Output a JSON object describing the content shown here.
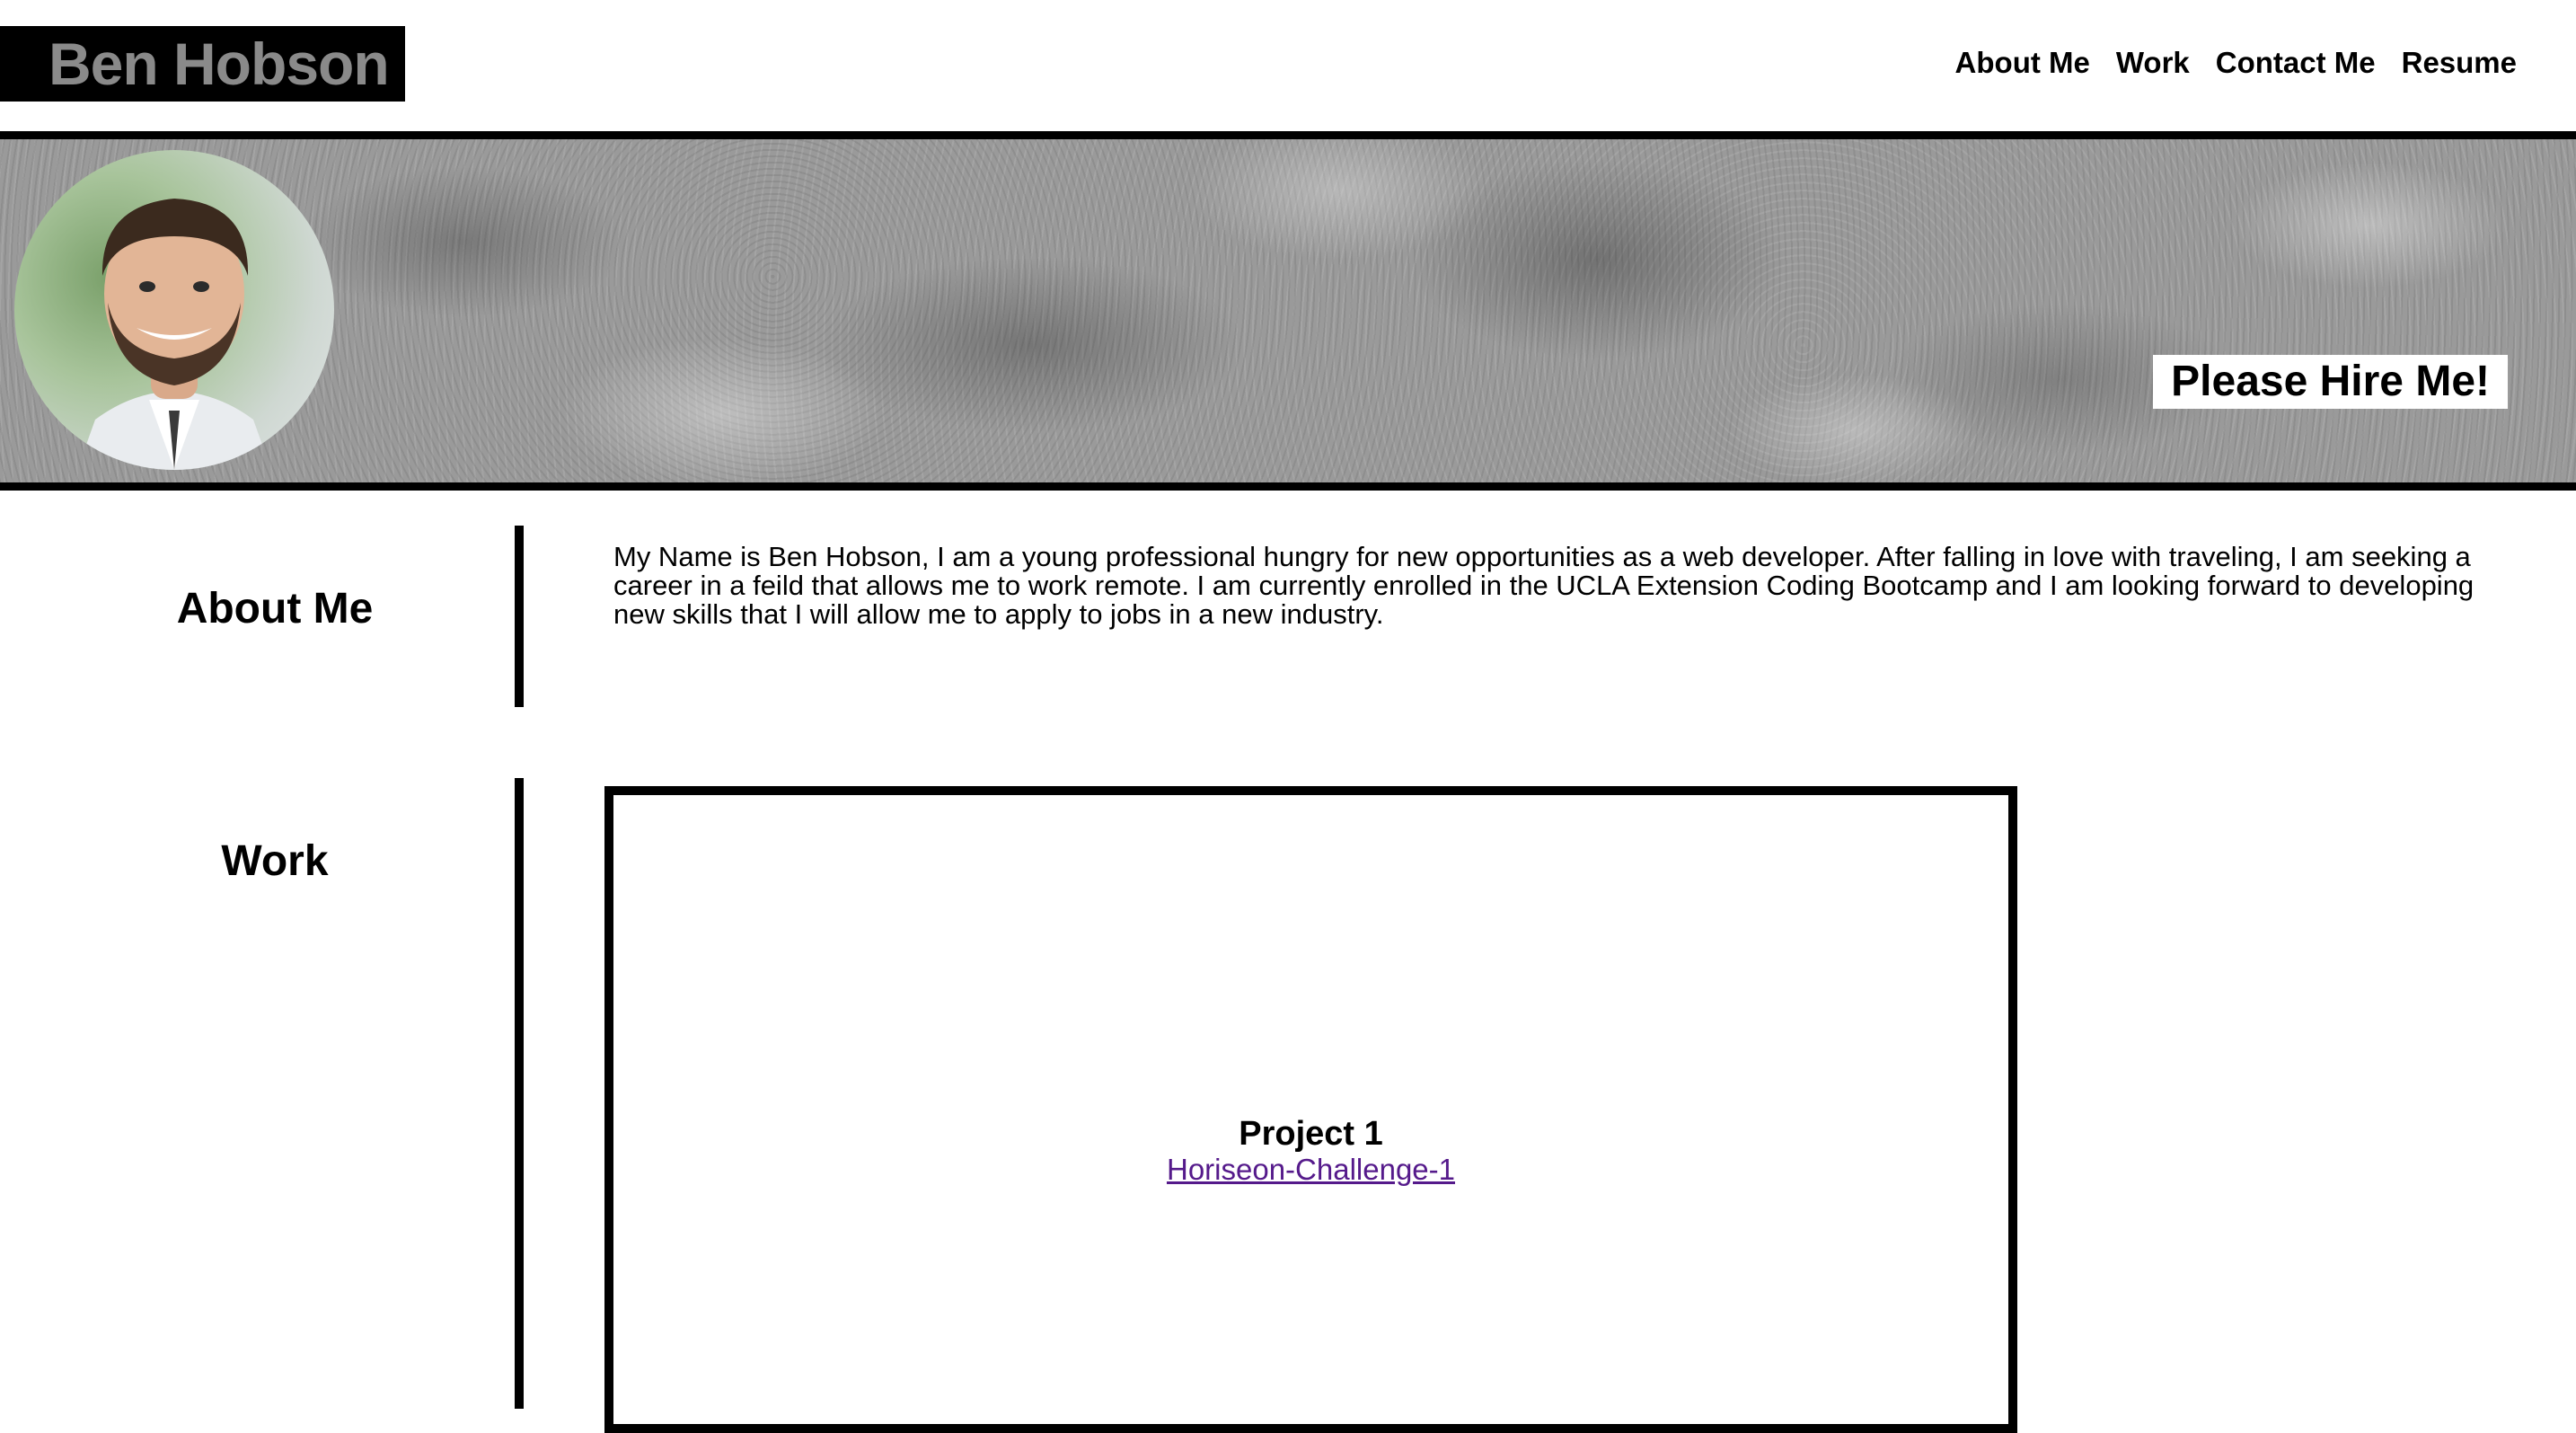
{
  "header": {
    "brand": "Ben Hobson",
    "nav": {
      "about": "About Me",
      "work": "Work",
      "contact": "Contact Me",
      "resume": "Resume"
    }
  },
  "hero": {
    "tagline": "Please Hire Me!"
  },
  "about": {
    "title": "About Me",
    "text": "My Name is Ben Hobson, I am a young professional hungry for new opportunities as a web developer. After falling in love with traveling, I am seeking a career in a feild that allows me to work remote. I am currently enrolled in the UCLA Extension Coding Bootcamp and I am looking forward to developing new skills that I will allow me to apply to jobs in a new industry."
  },
  "work": {
    "title": "Work",
    "projects": [
      {
        "title": "Project 1",
        "link_text": "Horiseon-Challenge-1"
      }
    ]
  },
  "colors": {
    "brand_bg": "#000000",
    "brand_text": "#8a8a8a",
    "visited_link": "#551a8b"
  }
}
